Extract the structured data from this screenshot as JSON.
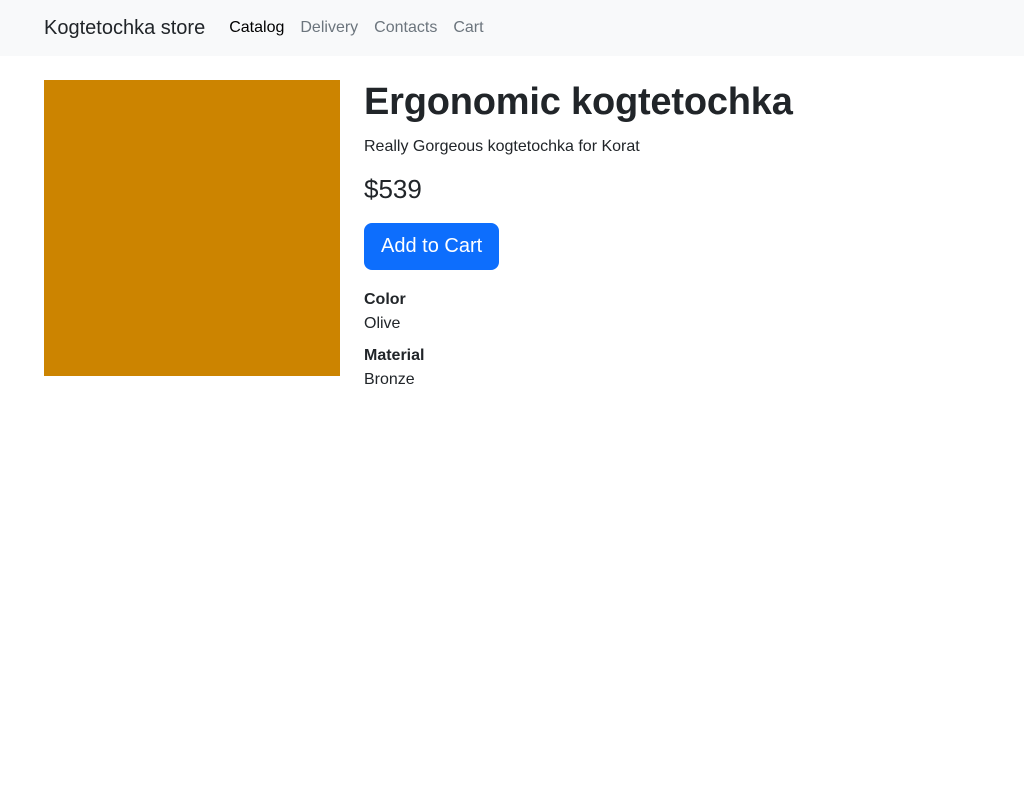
{
  "navbar": {
    "brand": "Kogtetochka store",
    "links": [
      {
        "label": "Catalog",
        "active": true
      },
      {
        "label": "Delivery",
        "active": false
      },
      {
        "label": "Contacts",
        "active": false
      },
      {
        "label": "Cart",
        "active": false
      }
    ]
  },
  "product": {
    "image_color": "#cc8400",
    "title": "Ergonomic kogtetochka",
    "description": "Really Gorgeous kogtetochka for Korat",
    "price": "$539",
    "add_to_cart_label": "Add to Cart",
    "attributes": [
      {
        "name": "Color",
        "value": "Olive"
      },
      {
        "name": "Material",
        "value": "Bronze"
      }
    ]
  },
  "colors": {
    "navbar_bg": "#f8f9fa",
    "primary_button": "#0d6efd",
    "text": "#212529",
    "nav_inactive": "#6c757d"
  }
}
